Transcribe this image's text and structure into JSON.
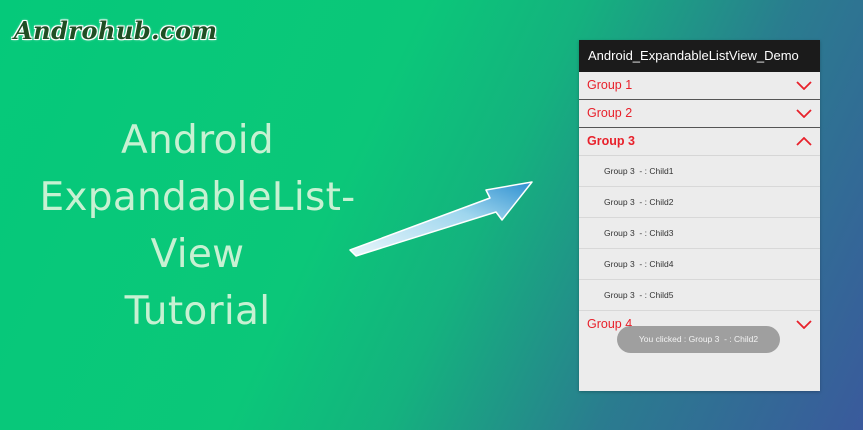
{
  "logo": {
    "text": "Androhub.com"
  },
  "headline": {
    "line1": "Android",
    "line2": "ExpandableList-",
    "line3": "View",
    "line4": "Tutorial"
  },
  "colors": {
    "group_text": "#e8212b",
    "action_bar": "#1b1b1b",
    "headline_text": "#c7f1d2",
    "toast_bg": "#9b9b9b"
  },
  "app": {
    "title": "Android_ExpandableListView_Demo",
    "groups": [
      {
        "label": "Group 1",
        "expanded": false,
        "icon": "chevron-down-icon"
      },
      {
        "label": "Group 2",
        "expanded": false,
        "icon": "chevron-down-icon"
      },
      {
        "label": "Group 3",
        "expanded": true,
        "icon": "chevron-up-icon"
      },
      {
        "label": "Group 4",
        "expanded": false,
        "icon": "chevron-down-icon"
      }
    ],
    "children": [
      "Group 3  - : Child1",
      "Group 3  - : Child2",
      "Group 3  - : Child3",
      "Group 3  - : Child4",
      "Group 3  - : Child5"
    ],
    "toast": "You clicked : Group 3  - : Child2"
  }
}
